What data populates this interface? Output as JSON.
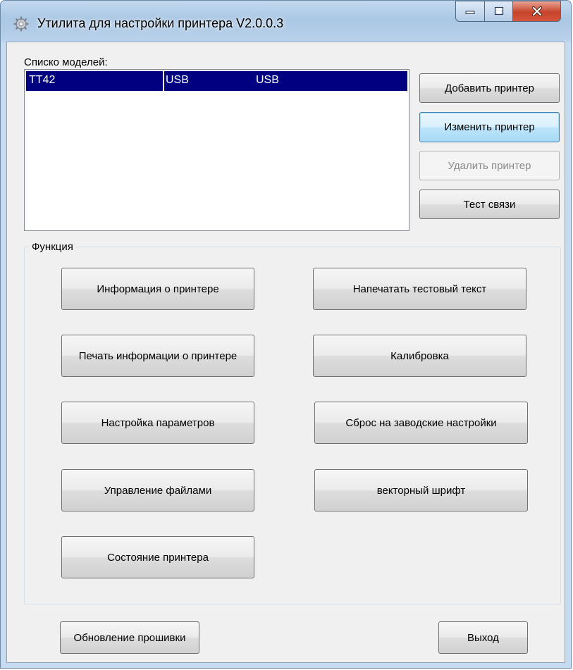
{
  "window": {
    "title": "Утилита для настройки принтера  V2.0.0.3",
    "caption_buttons": [
      "minimize-icon",
      "maximize-icon",
      "close-icon"
    ]
  },
  "models": {
    "label": "Списко моделей:",
    "rows": [
      {
        "name": "TT42",
        "port": "USB",
        "type": "USB",
        "selected": true
      }
    ]
  },
  "printer_buttons": {
    "add": "Добавить принтер",
    "edit": "Изменить принтер",
    "delete": "Удалить принтер",
    "test": "Тест связи"
  },
  "function_group": {
    "title": "Функция",
    "buttons": {
      "info": "Информация о принтере",
      "print_test": "Напечатать тестовый текст",
      "print_info": "Печать информации о принтере",
      "calibrate": "Калибровка",
      "params": "Настройка параметров",
      "reset": "Сброс на заводские настройки",
      "files": "Управление файлами",
      "vector_font": "векторный шрифт",
      "status": "Состояние принтера"
    }
  },
  "footer": {
    "firmware": "Обновление прошивки",
    "exit": "Выход"
  },
  "colors": {
    "selection": "#000080",
    "close_button": "#c6432b",
    "focus_border": "#3c7fb1"
  }
}
